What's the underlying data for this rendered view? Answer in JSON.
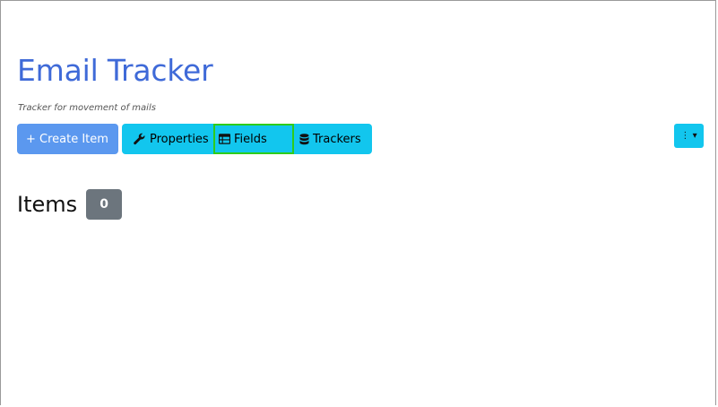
{
  "header": {
    "title": "Email Tracker",
    "subtitle": "Tracker for movement of mails"
  },
  "toolbar": {
    "create_label": "+ Create Item",
    "properties_label": "Properties",
    "fields_label": "Fields",
    "trackers_label": "Trackers",
    "selected": "Fields",
    "icons": {
      "properties": "wrench-icon",
      "fields": "table-icon",
      "trackers": "database-icon"
    }
  },
  "menu": {
    "kebab_label": "⋮ ▾"
  },
  "items": {
    "heading": "Items",
    "count": "0"
  },
  "colors": {
    "title": "#3f6ad8",
    "primary": "#5b98ef",
    "info": "#12c6ee",
    "badge": "#6c757d",
    "highlight": "#2ecc1a"
  }
}
